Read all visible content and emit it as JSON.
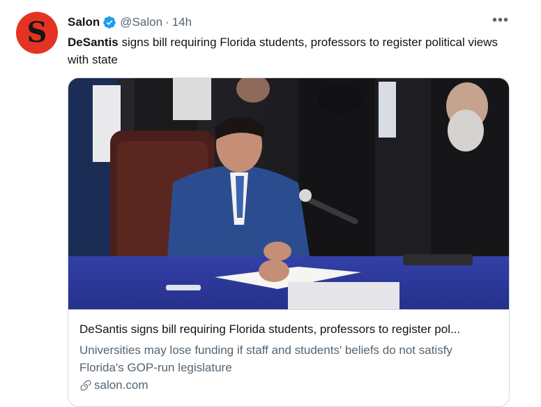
{
  "tweet": {
    "author_name": "Salon",
    "handle": "@Salon",
    "separator": "·",
    "time": "14h",
    "avatar_letter": "S",
    "more_label": "•••",
    "text_bold": "DeSantis",
    "text_rest": " signs bill requiring Florida students, professors to register political views with state"
  },
  "card": {
    "title": "DeSantis signs bill requiring Florida students, professors to register pol...",
    "description": "Universities may lose funding if staff and students' beliefs do not satisfy Florida's GOP-run legislature",
    "domain": "salon.com"
  },
  "colors": {
    "avatar_bg": "#e53323",
    "verified": "#1d9bf0",
    "secondary_text": "#536471",
    "border": "#cfd9de"
  },
  "icons": [
    "verified-badge-icon",
    "more-options-icon",
    "link-icon"
  ]
}
